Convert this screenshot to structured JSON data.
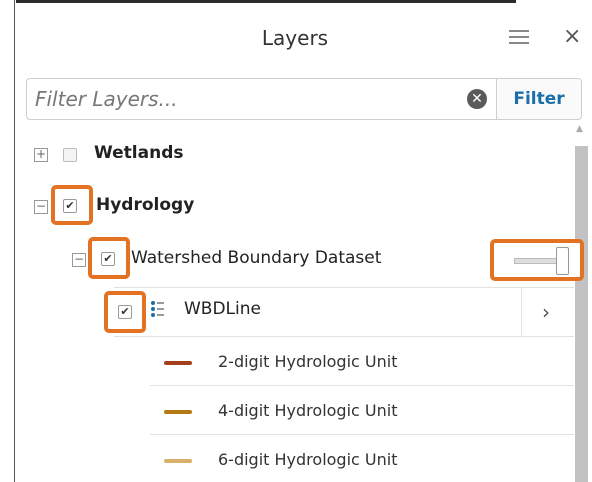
{
  "panel": {
    "title": "Layers",
    "close_glyph": "×",
    "menu_icon": "hamburger-icon"
  },
  "search": {
    "placeholder": "Filter Layers...",
    "value": "",
    "clear_glyph": "✕",
    "filter_label": "Filter"
  },
  "layers": {
    "wetlands": {
      "label": "Wetlands",
      "expander": "+",
      "checked": false
    },
    "hydrology": {
      "label": "Hydrology",
      "expander": "−",
      "checked": true,
      "check_glyph": "✔"
    },
    "watershed": {
      "label": "Watershed Boundary Dataset",
      "expander": "−",
      "checked": true,
      "check_glyph": "✔",
      "opacity_slider": 1.0
    },
    "wbdline": {
      "label": "WBDLine",
      "checked": true,
      "check_glyph": "✔",
      "chevron": "›"
    }
  },
  "legend": [
    {
      "label": "2-digit Hydrologic Unit",
      "color": "#a1401b"
    },
    {
      "label": "4-digit Hydrologic Unit",
      "color": "#b57a16"
    },
    {
      "label": "6-digit Hydrologic Unit",
      "color": "#d9b06a"
    }
  ],
  "colors": {
    "highlight": "#e37222",
    "filter_text": "#1a6fa8"
  }
}
